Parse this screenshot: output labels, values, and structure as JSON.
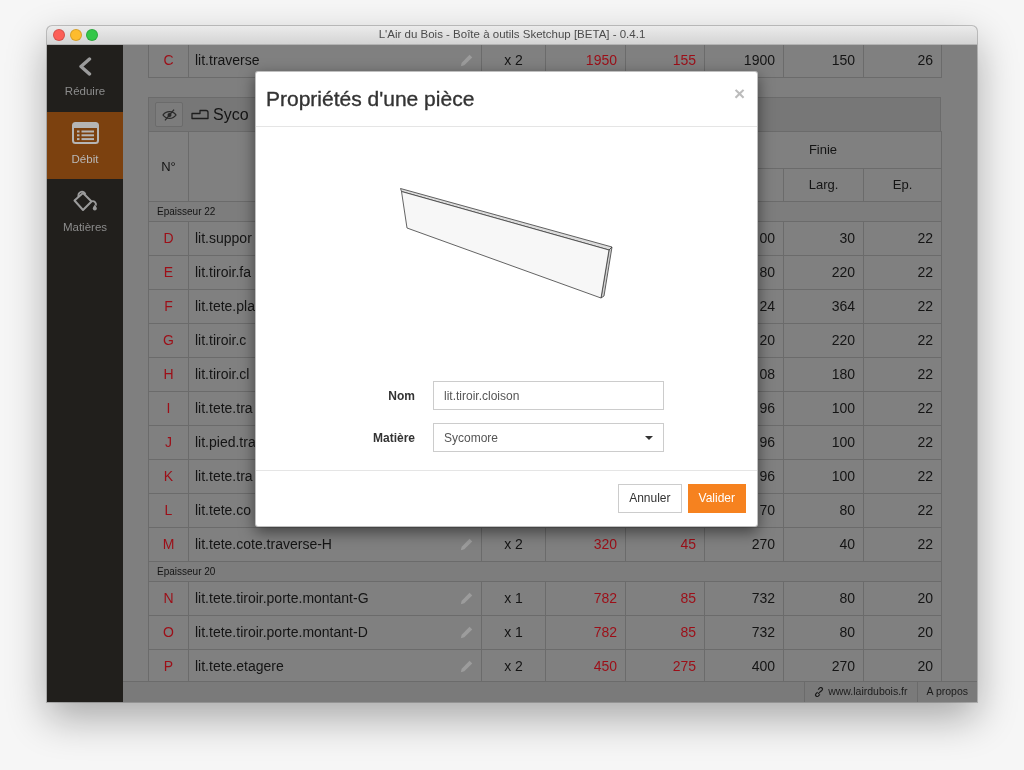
{
  "window": {
    "title": "L'Air du Bois - Boîte à outils Sketchup [BETA] - 0.4.1"
  },
  "sidebar": {
    "items": [
      {
        "kind": "collapse",
        "label": "Réduire",
        "selected": false
      },
      {
        "kind": "cutlist",
        "label": "Débit",
        "selected": true
      },
      {
        "kind": "materials",
        "label": "Matières",
        "selected": false
      }
    ]
  },
  "groups": [
    {
      "sections": [
        {
          "rows": [
            {
              "number": "C",
              "name": "lit.traverse",
              "quantity": "x 2",
              "raw": [
                "1950",
                "155"
              ],
              "finished": [
                "1900",
                "150",
                "26"
              ]
            }
          ]
        }
      ]
    },
    {
      "name": "Syco",
      "header": {
        "number": "N°",
        "group": "Finie",
        "subcolumns": [
          "Larg.",
          "Ep."
        ]
      },
      "sections": [
        {
          "label": "Epaisseur 22",
          "rows": [
            {
              "number": "D",
              "name": "lit.suppor",
              "finished": [
                "00",
                "30",
                "22"
              ]
            },
            {
              "number": "E",
              "name": "lit.tiroir.fa",
              "finished": [
                "80",
                "220",
                "22"
              ]
            },
            {
              "number": "F",
              "name": "lit.tete.pla",
              "finished": [
                "24",
                "364",
                "22"
              ]
            },
            {
              "number": "G",
              "name": "lit.tiroir.c",
              "finished": [
                "20",
                "220",
                "22"
              ]
            },
            {
              "number": "H",
              "name": "lit.tiroir.cl",
              "finished": [
                "08",
                "180",
                "22"
              ]
            },
            {
              "number": "I",
              "name": "lit.tete.tra",
              "finished": [
                "96",
                "100",
                "22"
              ]
            },
            {
              "number": "J",
              "name": "lit.pied.tra",
              "finished": [
                "96",
                "100",
                "22"
              ]
            },
            {
              "number": "K",
              "name": "lit.tete.tra",
              "finished": [
                "96",
                "100",
                "22"
              ]
            },
            {
              "number": "L",
              "name": "lit.tete.co",
              "finished": [
                "70",
                "80",
                "22"
              ]
            },
            {
              "number": "M",
              "name": "lit.tete.cote.traverse-H",
              "quantity": "x 2",
              "raw": [
                "320",
                "45"
              ],
              "finished": [
                "270",
                "40",
                "22"
              ]
            }
          ]
        },
        {
          "label": "Epaisseur 20",
          "rows": [
            {
              "number": "N",
              "name": "lit.tete.tiroir.porte.montant-G",
              "quantity": "x 1",
              "raw": [
                "782",
                "85"
              ],
              "finished": [
                "732",
                "80",
                "20"
              ]
            },
            {
              "number": "O",
              "name": "lit.tete.tiroir.porte.montant-D",
              "quantity": "x 1",
              "raw": [
                "782",
                "85"
              ],
              "finished": [
                "732",
                "80",
                "20"
              ]
            },
            {
              "number": "P",
              "name": "lit.tete.etagere",
              "quantity": "x 2",
              "raw": [
                "450",
                "275"
              ],
              "finished": [
                "400",
                "270",
                "20"
              ]
            }
          ]
        }
      ]
    }
  ],
  "status_bar": {
    "items": [
      {
        "kind": "link",
        "label": "www.lairdubois.fr"
      },
      {
        "kind": "text",
        "label": "A propos"
      }
    ]
  },
  "dialog": {
    "title": "Propriétés d'une pièce",
    "close": "×",
    "fields": [
      {
        "kind": "text",
        "label": "Nom",
        "value": "lit.tiroir.cloison"
      },
      {
        "kind": "select",
        "label": "Matière",
        "value": "Sycomore"
      }
    ],
    "buttons": [
      {
        "kind": "secondary",
        "label": "Annuler"
      },
      {
        "kind": "primary",
        "label": "Valider"
      }
    ]
  }
}
